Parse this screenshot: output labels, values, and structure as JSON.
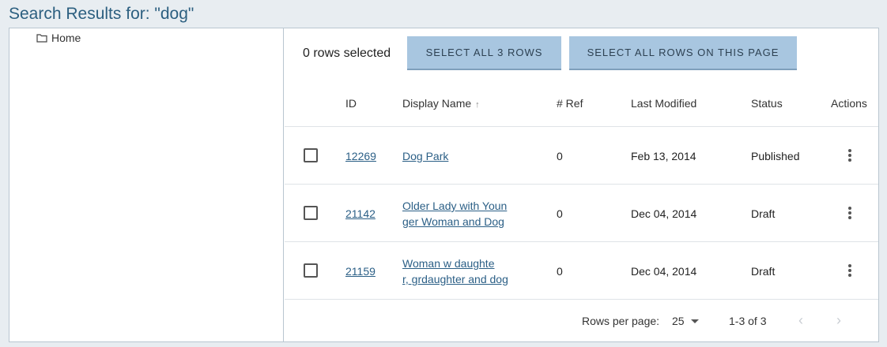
{
  "page": {
    "title": "Search Results for: \"dog\""
  },
  "tree": {
    "items": [
      {
        "label": "Home",
        "icon": "folder-icon"
      }
    ]
  },
  "toolbar": {
    "selected_text": "0 rows selected",
    "select_all_label": "SELECT ALL 3 ROWS",
    "select_page_label": "SELECT ALL ROWS ON THIS PAGE"
  },
  "table": {
    "columns": {
      "id": "ID",
      "display_name": "Display Name",
      "ref": "# Ref",
      "last_modified": "Last Modified",
      "status": "Status",
      "actions": "Actions"
    },
    "sort_icon": "↑",
    "rows": [
      {
        "id": "12269",
        "name_line1": "Dog Park",
        "name_line2": "",
        "ref": "0",
        "modified": "Feb 13, 2014",
        "status": "Published"
      },
      {
        "id": "21142",
        "name_line1": "Older Lady with Youn",
        "name_line2": "ger Woman and Dog",
        "ref": "0",
        "modified": "Dec 04, 2014",
        "status": "Draft"
      },
      {
        "id": "21159",
        "name_line1": "Woman w daughte",
        "name_line2": "r, grdaughter and dog",
        "ref": "0",
        "modified": "Dec 04, 2014",
        "status": "Draft"
      }
    ]
  },
  "pagination": {
    "rows_per_page_label": "Rows per page:",
    "rows_per_page_value": "25",
    "range_text": "1-3 of 3",
    "prev_icon": "‹",
    "next_icon": "›"
  },
  "colors": {
    "title": "#2c5f80",
    "button_bg": "#a8c6e0",
    "link": "#2b5f86"
  }
}
